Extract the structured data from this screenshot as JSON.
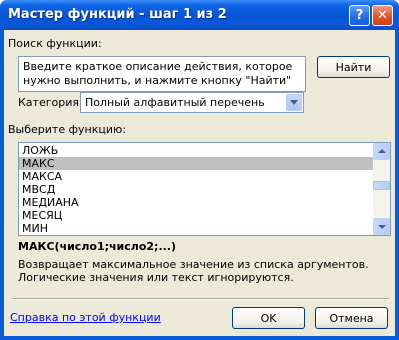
{
  "window": {
    "title": "Мастер функций - шаг 1 из 2",
    "help_glyph": "?",
    "close_glyph": "✕"
  },
  "search": {
    "label": "Поиск функции:",
    "text": "Введите краткое описание действия, которое нужно выполнить, и нажмите кнопку \"Найти\"",
    "find_button": "Найти"
  },
  "category": {
    "label": "Категория:",
    "value": "Полный алфавитный перечень"
  },
  "functions": {
    "label": "Выберите функцию:",
    "items": [
      "ЛОЖЬ",
      "МАКС",
      "МАКСА",
      "МВСД",
      "МЕДИАНА",
      "МЕСЯЦ",
      "МИН"
    ],
    "selected_index": 1
  },
  "details": {
    "signature": "МАКС(число1;число2;...)",
    "description": "Возвращает максимальное значение из списка аргументов. Логические значения или текст игнорируются."
  },
  "footer": {
    "help_link": "Справка по этой функции",
    "ok_button": "OK",
    "cancel_button": "Отмена"
  }
}
